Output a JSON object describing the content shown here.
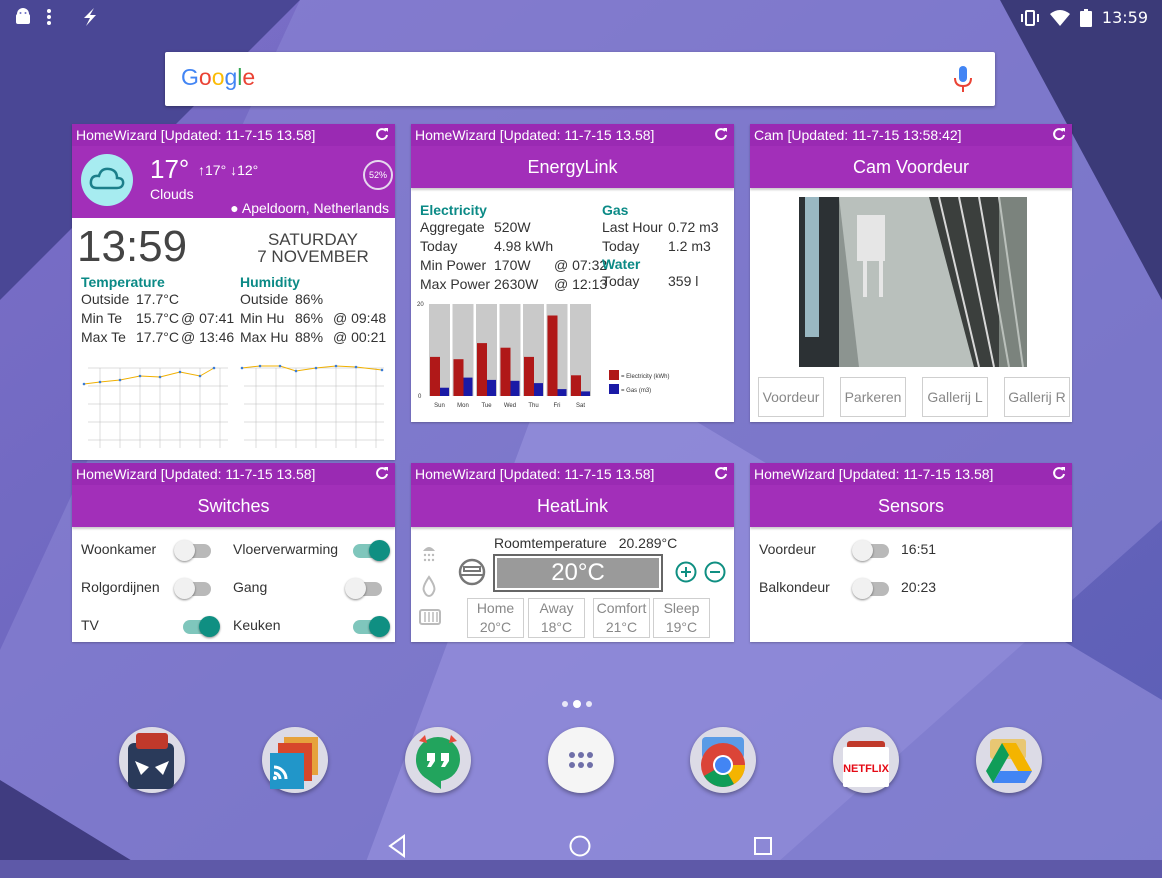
{
  "status": {
    "time": "13:59"
  },
  "search": {
    "logo_letters": [
      [
        "G",
        "#4285f4"
      ],
      [
        "o",
        "#ea4335"
      ],
      [
        "o",
        "#fbbc05"
      ],
      [
        "g",
        "#4285f4"
      ],
      [
        "l",
        "#34a853"
      ],
      [
        "e",
        "#ea4335"
      ]
    ]
  },
  "weather": {
    "header": "HomeWizard [Updated: 11-7-15 13.58]",
    "temp": "17°",
    "hi": "17°",
    "lo": "12°",
    "condition": "Clouds",
    "humidity_badge": "52%",
    "location": "Apeldoorn, Netherlands",
    "clock": "13:59",
    "day": "SATURDAY",
    "date": "7 NOVEMBER",
    "temperature_title": "Temperature",
    "humidity_title": "Humidity",
    "temp_rows": [
      [
        "Outside",
        "17.7°C",
        ""
      ],
      [
        "Min Te",
        "15.7°C",
        "@ 07:41"
      ],
      [
        "Max Te",
        "17.7°C",
        "@ 13:46"
      ]
    ],
    "hum_rows": [
      [
        "Outside",
        "86%",
        ""
      ],
      [
        "Min Hu",
        "86%",
        "@ 09:48"
      ],
      [
        "Max Hu",
        "88%",
        "@ 00:21"
      ]
    ]
  },
  "energy": {
    "header": "HomeWizard [Updated: 11-7-15 13.58]",
    "title": "EnergyLink",
    "electricity_title": "Electricity",
    "gas_title": "Gas",
    "water_title": "Water",
    "electricity_rows": [
      [
        "Aggregate",
        "520W",
        ""
      ],
      [
        "Today",
        "4.98 kWh",
        ""
      ],
      [
        "Min Power",
        "170W",
        "@ 07:32"
      ],
      [
        "Max Power",
        "2630W",
        "@ 12:13"
      ]
    ],
    "gas_rows": [
      [
        "Last Hour",
        "0.72 m3"
      ],
      [
        "Today",
        "1.2 m3"
      ]
    ],
    "water_rows": [
      [
        "Today",
        "359 l"
      ]
    ],
    "chart_ymax": "20",
    "chart_ymin": "0",
    "legend_elec": "= Electricity (kWh)",
    "legend_gas": "= Gas (m3)"
  },
  "chart_data": {
    "type": "bar",
    "categories": [
      "Sun",
      "Mon",
      "Tue",
      "Wed",
      "Thu",
      "Fri",
      "Sat"
    ],
    "ylim": [
      0,
      20
    ],
    "series": [
      {
        "name": "= Electricity (kWh)",
        "color": "#b01818",
        "values": [
          8.5,
          8,
          11.5,
          10.5,
          8.5,
          17.5,
          4.5
        ]
      },
      {
        "name": "= Gas (m3)",
        "color": "#1a1aa6",
        "values": [
          1.8,
          4,
          3.5,
          3.3,
          2.8,
          1.5,
          1
        ]
      }
    ]
  },
  "cam": {
    "header": "Cam [Updated: 11-7-15 13:58:42]",
    "title": "Cam Voordeur",
    "buttons": [
      "Voordeur",
      "Parkeren",
      "Gallerij L",
      "Gallerij R"
    ]
  },
  "switches": {
    "header": "HomeWizard [Updated: 11-7-15 13.58]",
    "title": "Switches",
    "items": [
      {
        "label": "Woonkamer",
        "on": false
      },
      {
        "label": "Vloerverwarming",
        "on": true
      },
      {
        "label": "Rolgordijnen",
        "on": false
      },
      {
        "label": "Gang",
        "on": false
      },
      {
        "label": "TV",
        "on": true
      },
      {
        "label": "Keuken",
        "on": true
      }
    ]
  },
  "heat": {
    "header": "HomeWizard [Updated: 11-7-15 13.58]",
    "title": "HeatLink",
    "room_label": "Roomtemperature",
    "room_value": "20.289°C",
    "setpoint": "20°C",
    "presets": [
      [
        "Home",
        "20°C"
      ],
      [
        "Away",
        "18°C"
      ],
      [
        "Comfort",
        "21°C"
      ],
      [
        "Sleep",
        "19°C"
      ]
    ]
  },
  "sensors": {
    "header": "HomeWizard [Updated: 11-7-15 13.58]",
    "title": "Sensors",
    "items": [
      [
        "Voordeur",
        "16:51"
      ],
      [
        "Balkondeur",
        "20:23"
      ]
    ]
  },
  "dock": {
    "netflix_label": "NETFLIX"
  }
}
